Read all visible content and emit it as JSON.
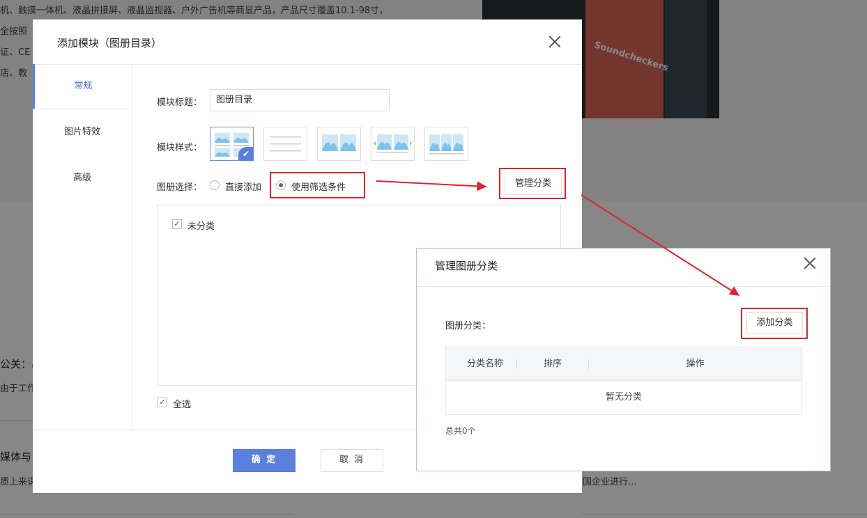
{
  "background": {
    "lines": [
      "机、触摸一体机、液晶拼接屏、液晶监视器、户外广告机等商显产品，产品尺寸覆盖10.1-98寸，",
      "全按照",
      "证、CE",
      "店、教",
      "公关：出",
      "由于工作",
      "媒体与",
      "质上来说",
      "国企业进行..."
    ],
    "photo_text": "Soundcheckers"
  },
  "main_dialog": {
    "title": "添加模块（图册目录）",
    "side_tabs": [
      {
        "label": "常规",
        "active": true
      },
      {
        "label": "图片特效",
        "active": false
      },
      {
        "label": "高级",
        "active": false
      }
    ],
    "module_title_label": "模块标题：",
    "module_title_value": "图册目录",
    "module_style_label": "模块样式：",
    "album_select_label": "图册选择：",
    "radio_direct": "直接添加",
    "radio_filter": "使用筛选条件",
    "manage_button": "管理分类",
    "list_items": [
      {
        "label": "未分类",
        "checked": true
      }
    ],
    "select_all": "全选",
    "confirm": "确 定",
    "cancel": "取 消"
  },
  "manage_dialog": {
    "title": "管理图册分类",
    "category_label": "图册分类：",
    "add_button": "添加分类",
    "columns": [
      "分类名称",
      "排序",
      "操作"
    ],
    "empty_text": "暂无分类",
    "total": "总共0个"
  },
  "colors": {
    "primary": "#5b7fde",
    "highlight": "#e0232b",
    "overlay": "#000000"
  },
  "icons": [
    "close-icon",
    "check-icon",
    "arrow-icon"
  ]
}
